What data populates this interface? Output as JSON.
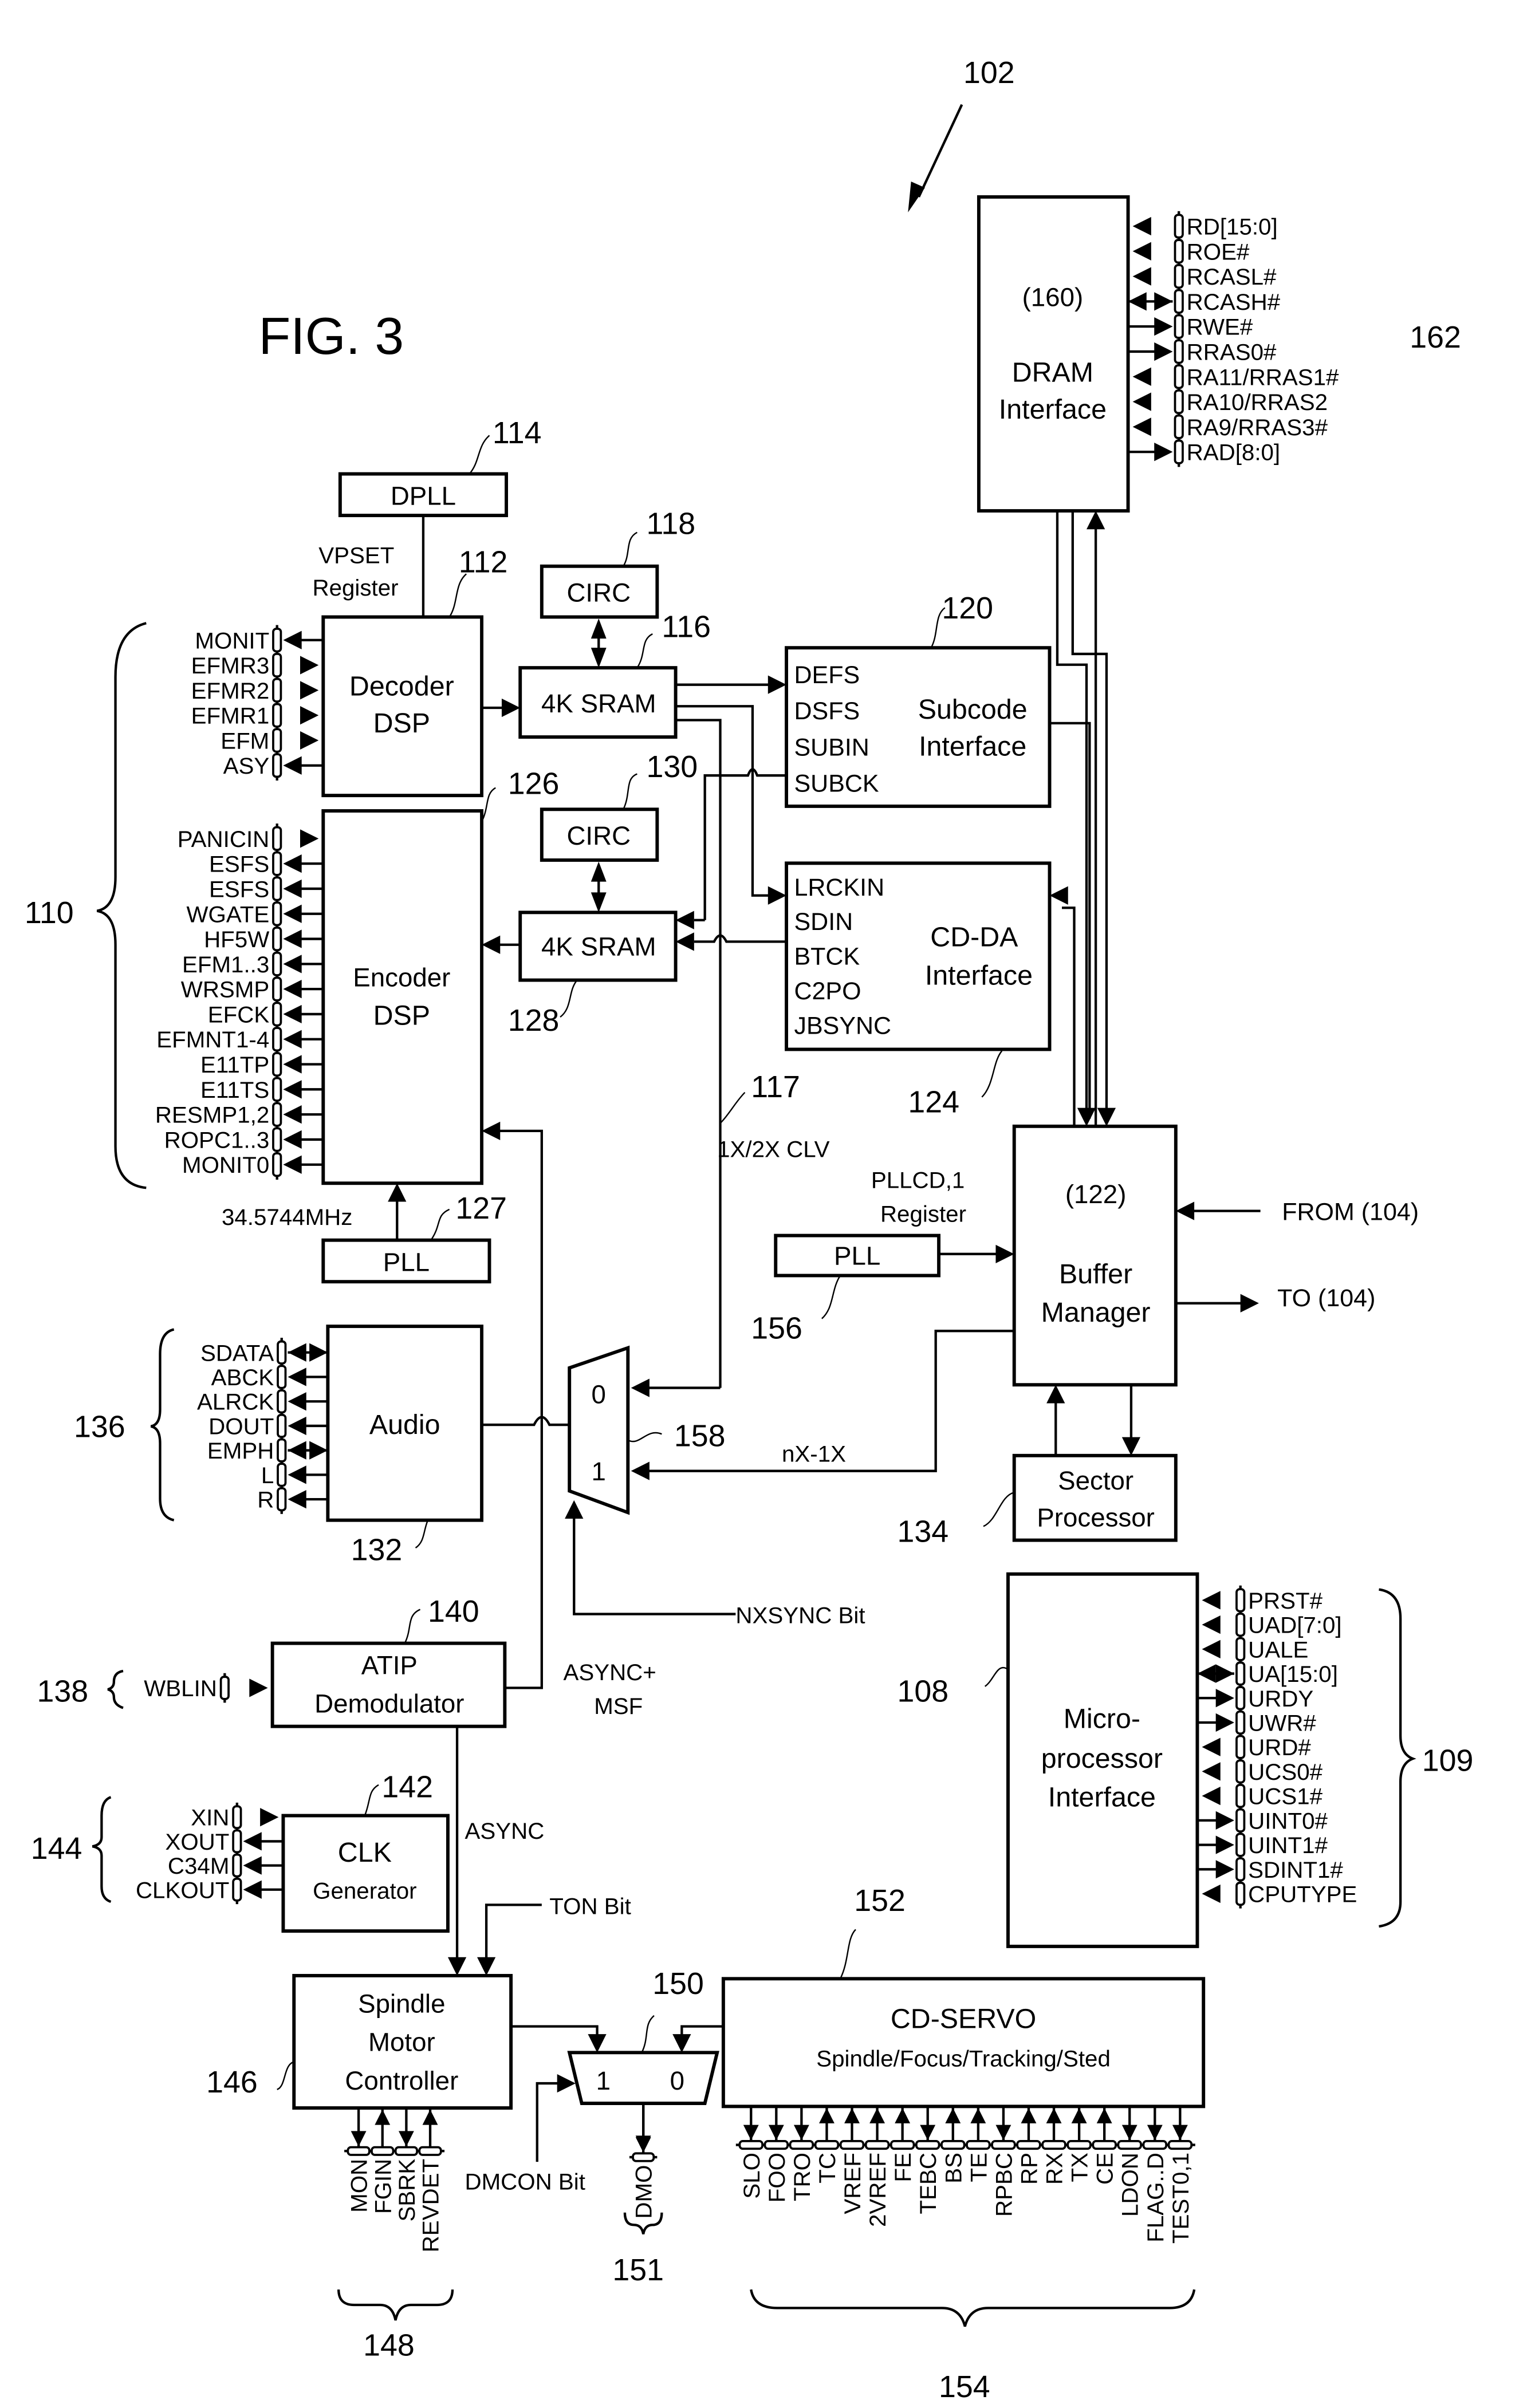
{
  "figure": {
    "title": "FIG. 3",
    "system_ref": "102"
  },
  "blocks": {
    "dram": {
      "ref": "(160)",
      "line1": "DRAM",
      "line2": "Interface"
    },
    "dpll": {
      "label": "DPLL",
      "ref": "114"
    },
    "vpset": {
      "line1": "VPSET",
      "line2": "Register"
    },
    "decoder": {
      "line1": "Decoder",
      "line2": "DSP",
      "ref": "112"
    },
    "circ1": {
      "label": "CIRC",
      "ref": "118"
    },
    "sram1": {
      "label": "4K SRAM",
      "ref": "116"
    },
    "subcode": {
      "line1": "Subcode",
      "line2": "Interface",
      "ref": "120",
      "signals": [
        "DEFS",
        "DSFS",
        "SUBIN",
        "SUBCK"
      ]
    },
    "encoder": {
      "line1": "Encoder",
      "line2": "DSP",
      "ref": "126"
    },
    "circ2": {
      "label": "CIRC",
      "ref": "130"
    },
    "sram2": {
      "label": "4K SRAM",
      "ref": "128"
    },
    "cdda": {
      "line1": "CD-DA",
      "line2": "Interface",
      "ref": "124",
      "signals": [
        "LRCKIN",
        "SDIN",
        "BTCK",
        "C2PO",
        "JBSYNC"
      ]
    },
    "pll_enc": {
      "label": "PLL",
      "ref": "127",
      "freq": "34.5744MHz"
    },
    "buffer": {
      "ref": "(122)",
      "line1": "Buffer",
      "line2": "Manager"
    },
    "pll_buf": {
      "label": "PLL",
      "ref": "156",
      "reg1": "PLLCD,1",
      "reg2": "Register"
    },
    "audio": {
      "label": "Audio",
      "ref": "132"
    },
    "mux158": {
      "in0": "0",
      "in1": "1",
      "ref": "158"
    },
    "sector": {
      "line1": "Sector",
      "line2": "Processor",
      "ref": "134"
    },
    "atip": {
      "line1": "ATIP",
      "line2": "Demodulator",
      "ref": "140"
    },
    "micro": {
      "line1": "Micro-",
      "line2": "processor",
      "line3": "Interface",
      "ref": "108"
    },
    "clk": {
      "line1": "CLK",
      "line2": "Generator",
      "ref": "142"
    },
    "spindle": {
      "line1": "Spindle",
      "line2": "Motor",
      "line3": "Controller",
      "ref": "146"
    },
    "mux150": {
      "in1": "1",
      "in0": "0",
      "ref": "150"
    },
    "servo": {
      "line1": "CD-SERVO",
      "line2": "Spindle/Focus/Tracking/Sted",
      "ref": "152"
    }
  },
  "signals": {
    "clv": "1X/2X CLV",
    "clv_ref": "117",
    "from104": "FROM (104)",
    "to104": "TO (104)",
    "nx1x": "nX-1X",
    "nxsync": "NXSYNC Bit",
    "async_msf1": "ASYNC+",
    "async_msf2": "MSF",
    "async": "ASYNC",
    "ton": "TON Bit",
    "dmcon": "DMCON Bit"
  },
  "pin_groups": {
    "dram_162": {
      "ref": "162",
      "pins": [
        {
          "name": "RD[15:0]",
          "dir": "in"
        },
        {
          "name": "ROE#",
          "dir": "in"
        },
        {
          "name": "RCASL#",
          "dir": "in"
        },
        {
          "name": "RCASH#",
          "dir": "bi"
        },
        {
          "name": "RWE#",
          "dir": "out"
        },
        {
          "name": "RRAS0#",
          "dir": "out"
        },
        {
          "name": "RA11/RRAS1#",
          "dir": "in"
        },
        {
          "name": "RA10/RRAS2",
          "dir": "in"
        },
        {
          "name": "RA9/RRAS3#",
          "dir": "in"
        },
        {
          "name": "RAD[8:0]",
          "dir": "out"
        }
      ]
    },
    "decoder_110a": {
      "pins": [
        {
          "name": "MONIT",
          "dir": "out"
        },
        {
          "name": "EFMR3",
          "dir": "in"
        },
        {
          "name": "EFMR2",
          "dir": "in"
        },
        {
          "name": "EFMR1",
          "dir": "in"
        },
        {
          "name": "EFM",
          "dir": "in"
        },
        {
          "name": "ASY",
          "dir": "out"
        }
      ]
    },
    "encoder_110b": {
      "pins": [
        {
          "name": "PANICIN",
          "dir": "in"
        },
        {
          "name": "ESFS",
          "dir": "out"
        },
        {
          "name": "ESFS",
          "dir": "out"
        },
        {
          "name": "WGATE",
          "dir": "out"
        },
        {
          "name": "HF5W",
          "dir": "out"
        },
        {
          "name": "EFM1..3",
          "dir": "out"
        },
        {
          "name": "WRSMP",
          "dir": "out"
        },
        {
          "name": "EFCK",
          "dir": "out"
        },
        {
          "name": "EFMNT1-4",
          "dir": "out"
        },
        {
          "name": "E11TP",
          "dir": "out"
        },
        {
          "name": "E11TS",
          "dir": "out"
        },
        {
          "name": "RESMP1,2",
          "dir": "out"
        },
        {
          "name": "ROPC1..3",
          "dir": "out"
        },
        {
          "name": "MONIT0",
          "dir": "out"
        }
      ]
    },
    "group_110": {
      "ref": "110"
    },
    "audio_136": {
      "ref": "136",
      "pins": [
        {
          "name": "SDATA",
          "dir": "bi"
        },
        {
          "name": "ABCK",
          "dir": "out"
        },
        {
          "name": "ALRCK",
          "dir": "out"
        },
        {
          "name": "DOUT",
          "dir": "out"
        },
        {
          "name": "EMPH",
          "dir": "bi"
        },
        {
          "name": "L",
          "dir": "out"
        },
        {
          "name": "R",
          "dir": "out"
        }
      ]
    },
    "atip_138": {
      "ref": "138",
      "pins": [
        {
          "name": "WBLIN",
          "dir": "in"
        }
      ]
    },
    "micro_109": {
      "ref": "109",
      "pins": [
        {
          "name": "PRST#",
          "dir": "in"
        },
        {
          "name": "UAD[7:0]",
          "dir": "in"
        },
        {
          "name": "UALE",
          "dir": "in"
        },
        {
          "name": "UA[15:0]",
          "dir": "bi"
        },
        {
          "name": "URDY",
          "dir": "out"
        },
        {
          "name": "UWR#",
          "dir": "out"
        },
        {
          "name": "URD#",
          "dir": "in"
        },
        {
          "name": "UCS0#",
          "dir": "in"
        },
        {
          "name": "UCS1#",
          "dir": "in"
        },
        {
          "name": "UINT0#",
          "dir": "out"
        },
        {
          "name": "UINT1#",
          "dir": "out"
        },
        {
          "name": "SDINT1#",
          "dir": "out"
        },
        {
          "name": "CPUTYPE",
          "dir": "in"
        }
      ]
    },
    "clk_144": {
      "ref": "144",
      "pins": [
        {
          "name": "XIN",
          "dir": "in"
        },
        {
          "name": "XOUT",
          "dir": "out"
        },
        {
          "name": "C34M",
          "dir": "out"
        },
        {
          "name": "CLKOUT",
          "dir": "out"
        }
      ]
    },
    "spindle_148": {
      "ref": "148",
      "pins": [
        {
          "name": "MON",
          "dir": "down"
        },
        {
          "name": "FGIN",
          "dir": "up"
        },
        {
          "name": "SBRK",
          "dir": "down"
        },
        {
          "name": "REVDET",
          "dir": "up"
        }
      ]
    },
    "dmo_151": {
      "ref": "151",
      "pins": [
        {
          "name": "DMO",
          "dir": "down"
        }
      ]
    },
    "servo_154": {
      "ref": "154",
      "pins": [
        {
          "name": "SLO",
          "dir": "down"
        },
        {
          "name": "FOO",
          "dir": "down"
        },
        {
          "name": "TRO",
          "dir": "down"
        },
        {
          "name": "TC",
          "dir": "up"
        },
        {
          "name": "VREF",
          "dir": "up"
        },
        {
          "name": "2VREF",
          "dir": "up"
        },
        {
          "name": "FE",
          "dir": "up"
        },
        {
          "name": "TEBC",
          "dir": "down"
        },
        {
          "name": "BS",
          "dir": "up"
        },
        {
          "name": "TE",
          "dir": "up"
        },
        {
          "name": "RPBC",
          "dir": "down"
        },
        {
          "name": "RP",
          "dir": "up"
        },
        {
          "name": "RX",
          "dir": "up"
        },
        {
          "name": "TX",
          "dir": "up"
        },
        {
          "name": "CE",
          "dir": "up"
        },
        {
          "name": "LDON",
          "dir": "down"
        },
        {
          "name": "FLAG..D",
          "dir": "down"
        },
        {
          "name": "TEST0,1",
          "dir": "down"
        }
      ]
    }
  }
}
